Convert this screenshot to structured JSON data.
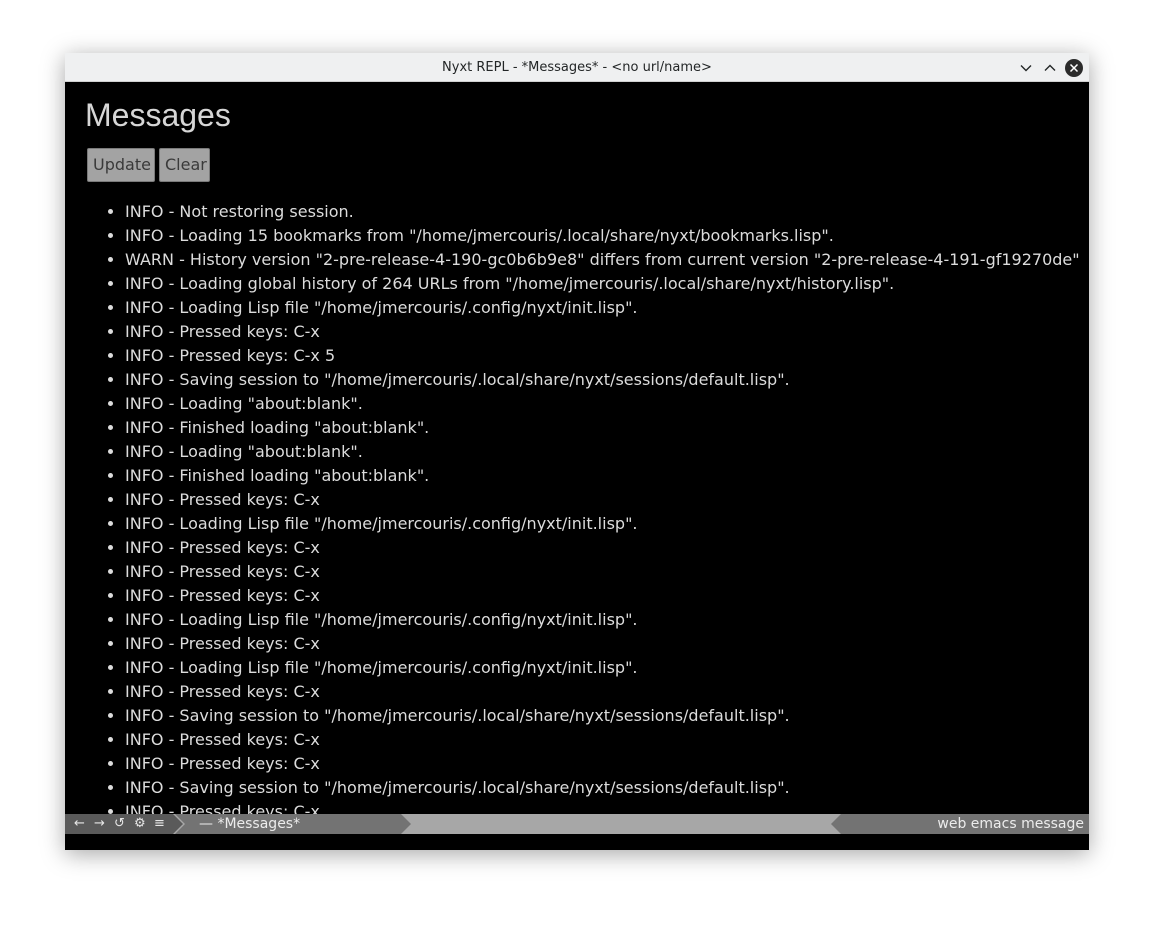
{
  "window": {
    "title": "Nyxt REPL - *Messages* - <no url/name>"
  },
  "page": {
    "heading": "Messages",
    "update_label": "Update",
    "clear_label": "Clear"
  },
  "log": [
    "INFO - Not restoring session.",
    "INFO - Loading 15 bookmarks from \"/home/jmercouris/.local/share/nyxt/bookmarks.lisp\".",
    "WARN - History version \"2-pre-release-4-190-gc0b6b9e8\" differs from current version \"2-pre-release-4-191-gf19270de\"",
    "INFO - Loading global history of 264 URLs from \"/home/jmercouris/.local/share/nyxt/history.lisp\".",
    "INFO - Loading Lisp file \"/home/jmercouris/.config/nyxt/init.lisp\".",
    "INFO - Pressed keys: C-x",
    "INFO - Pressed keys: C-x 5",
    "INFO - Saving session to \"/home/jmercouris/.local/share/nyxt/sessions/default.lisp\".",
    "INFO - Loading \"about:blank\".",
    "INFO - Finished loading \"about:blank\".",
    "INFO - Loading \"about:blank\".",
    "INFO - Finished loading \"about:blank\".",
    "INFO - Pressed keys: C-x",
    "INFO - Loading Lisp file \"/home/jmercouris/.config/nyxt/init.lisp\".",
    "INFO - Pressed keys: C-x",
    "INFO - Pressed keys: C-x",
    "INFO - Pressed keys: C-x",
    "INFO - Loading Lisp file \"/home/jmercouris/.config/nyxt/init.lisp\".",
    "INFO - Pressed keys: C-x",
    "INFO - Loading Lisp file \"/home/jmercouris/.config/nyxt/init.lisp\".",
    "INFO - Pressed keys: C-x",
    "INFO - Saving session to \"/home/jmercouris/.local/share/nyxt/sessions/default.lisp\".",
    "INFO - Pressed keys: C-x",
    "INFO - Pressed keys: C-x",
    "INFO - Saving session to \"/home/jmercouris/.local/share/nyxt/sessions/default.lisp\".",
    "INFO - Pressed keys: C-x"
  ],
  "statusbar": {
    "controls": {
      "back": "←",
      "forward": "→",
      "reload": "↺",
      "settings": "⚙",
      "menu": "≡"
    },
    "buffer": "— *Messages*",
    "modes": "web emacs message"
  },
  "icons": {
    "minimize": "chevron-down-icon",
    "maximize": "chevron-up-icon",
    "close": "close-icon"
  }
}
